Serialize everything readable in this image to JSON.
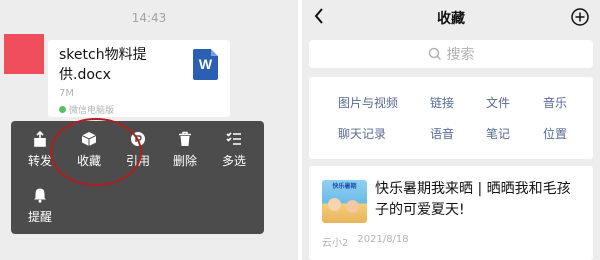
{
  "chat": {
    "time": "14:43",
    "file": {
      "name": "sketch物料提供.docx",
      "size": "7M",
      "source": "微信电脑版",
      "type_icon": "word-icon",
      "type_letter": "W"
    },
    "menu": {
      "items": [
        {
          "label": "转发",
          "icon": "share-icon"
        },
        {
          "label": "收藏",
          "icon": "favorite-cube-icon"
        },
        {
          "label": "引用",
          "icon": "quote-icon"
        },
        {
          "label": "删除",
          "icon": "trash-icon"
        },
        {
          "label": "多选",
          "icon": "multiselect-icon"
        },
        {
          "label": "提醒",
          "icon": "bell-icon"
        }
      ]
    }
  },
  "favorites": {
    "title": "收藏",
    "search_placeholder": "搜索",
    "categories": [
      "图片与视频",
      "链接",
      "文件",
      "音乐",
      "聊天记录",
      "语音",
      "笔记",
      "位置"
    ],
    "card": {
      "thumb_text": "快乐暑期",
      "title": "快乐暑期我来晒 | 晒晒我和毛孩子的可爱夏天!",
      "author": "云小2",
      "date": "2021/8/18"
    }
  },
  "colors": {
    "avatar": "#f04e5c",
    "menu_bg": "#4c4c4c",
    "link_blue": "#576b95",
    "highlight_ring": "#b01e1e",
    "word_blue": "#2a5fb4"
  }
}
